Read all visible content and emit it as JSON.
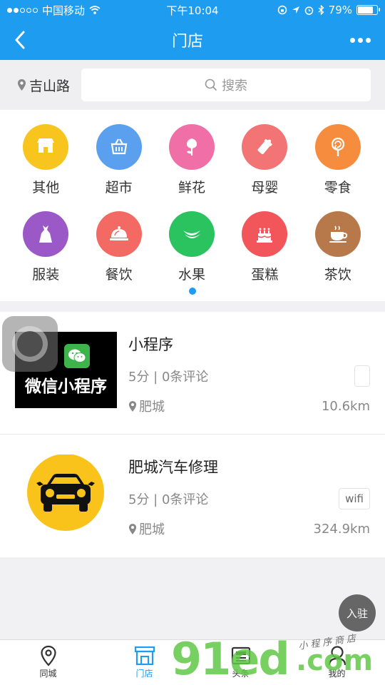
{
  "status_bar": {
    "carrier": "中国移动",
    "time": "下午10:04",
    "battery_text": "79%",
    "battery_level": 0.79
  },
  "nav": {
    "title": "门店"
  },
  "search": {
    "location": "吉山路",
    "placeholder": "搜索"
  },
  "categories": [
    {
      "label": "其他",
      "color": "#f7c51d",
      "icon": "store-icon"
    },
    {
      "label": "超市",
      "color": "#5aa0ef",
      "icon": "basket-icon"
    },
    {
      "label": "鲜花",
      "color": "#ef6fa6",
      "icon": "flower-icon"
    },
    {
      "label": "母婴",
      "color": "#f27474",
      "icon": "baby-bottle-icon"
    },
    {
      "label": "零食",
      "color": "#f68d3e",
      "icon": "lollipop-icon"
    },
    {
      "label": "服装",
      "color": "#9b59c8",
      "icon": "dress-icon"
    },
    {
      "label": "餐饮",
      "color": "#f26a63",
      "icon": "cloche-icon"
    },
    {
      "label": "水果",
      "color": "#2bc35f",
      "icon": "banana-icon"
    },
    {
      "label": "蛋糕",
      "color": "#f2555a",
      "icon": "cake-icon"
    },
    {
      "label": "茶饮",
      "color": "#b7794a",
      "icon": "teacup-icon"
    }
  ],
  "stores": [
    {
      "name": "小程序",
      "thumb_text": "微信小程序",
      "rating": "5分 | 0条评论",
      "location": "肥城",
      "distance": "10.6km",
      "tag": ""
    },
    {
      "name": "肥城汽车修理",
      "rating": "5分 | 0条评论",
      "location": "肥城",
      "distance": "324.9km",
      "tag": "wifi"
    }
  ],
  "join_button": "入驻",
  "tabs": [
    {
      "label": "同城",
      "icon": "location-pin-icon",
      "active": false
    },
    {
      "label": "门店",
      "icon": "storefront-icon",
      "active": true
    },
    {
      "label": "头条",
      "icon": "news-icon",
      "active": false
    },
    {
      "label": "我的",
      "icon": "user-icon",
      "active": false
    }
  ],
  "watermark": {
    "big": "91ed",
    "com": ".com",
    "small": "小程序商店"
  },
  "colors": {
    "primary": "#1e9cf0",
    "background": "#f1f1f3",
    "car_badge": "#f9c31b"
  }
}
